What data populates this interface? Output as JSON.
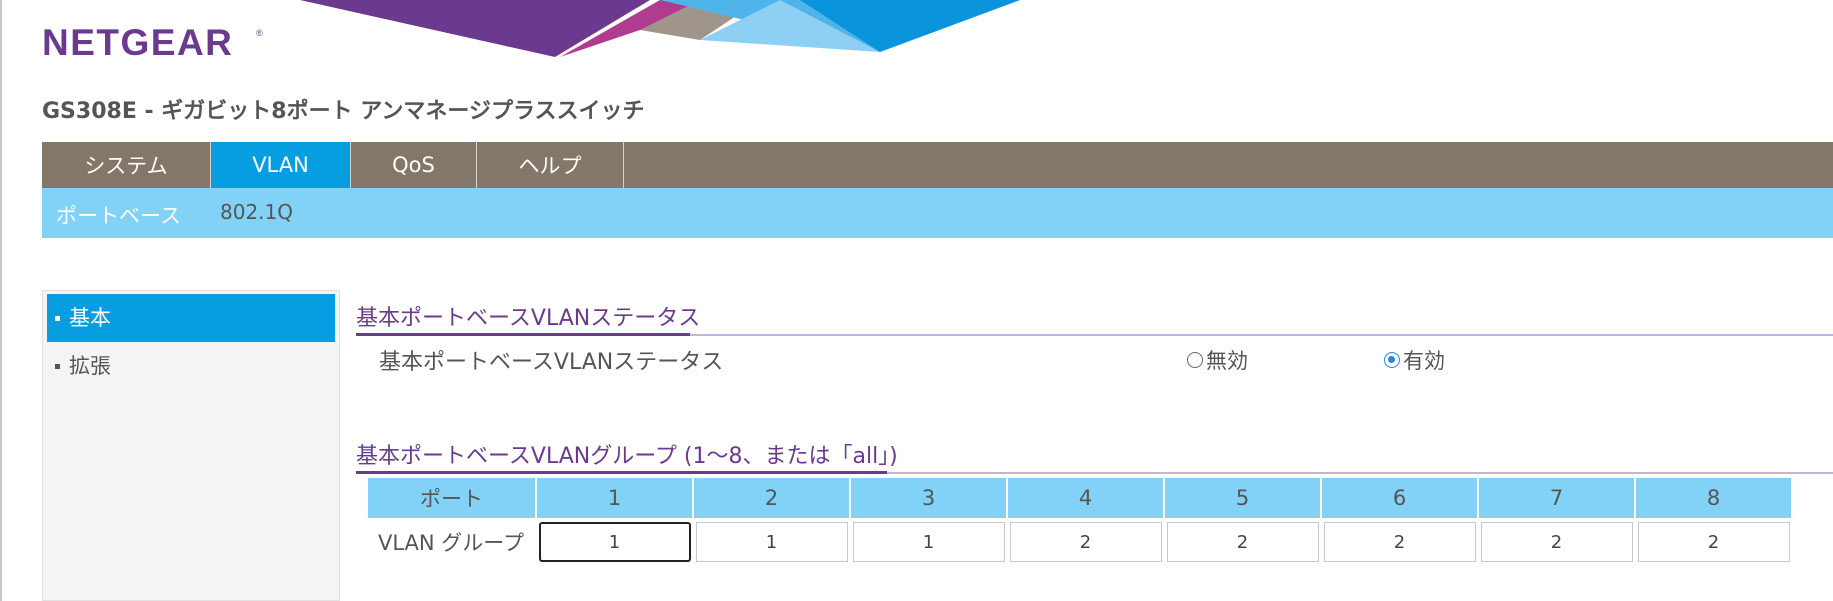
{
  "brand": {
    "logo_text": "NETGEAR",
    "logo_mark": "®",
    "accent_purple": "#6b3a8e",
    "accent_blue": "#069ee0",
    "light_blue": "#82d1f6",
    "nav_brown": "#837769"
  },
  "product_title": "GS308E - ギガビット8ポート アンマネージプラススイッチ",
  "top_nav": [
    {
      "label": "システム",
      "active": false
    },
    {
      "label": "VLAN",
      "active": true
    },
    {
      "label": "QoS",
      "active": false
    },
    {
      "label": "ヘルプ",
      "active": false
    }
  ],
  "sub_nav": [
    {
      "label": "ポートベース",
      "active": true
    },
    {
      "label": "802.1Q",
      "active": false
    }
  ],
  "side_menu": [
    {
      "label": "基本",
      "active": true
    },
    {
      "label": "拡張",
      "active": false
    }
  ],
  "status_section": {
    "title": "基本ポートベースVLANステータス",
    "field_label": "基本ポートベースVLANステータス",
    "options": [
      {
        "label": "無効",
        "checked": false
      },
      {
        "label": "有効",
        "checked": true
      }
    ]
  },
  "group_section": {
    "title": "基本ポートベースVLANグループ (1〜8、または「all」)",
    "port_header": "ポート",
    "row_label": "VLAN グループ",
    "ports": [
      "1",
      "2",
      "3",
      "4",
      "5",
      "6",
      "7",
      "8"
    ],
    "values": [
      "1",
      "1",
      "1",
      "2",
      "2",
      "2",
      "2",
      "2"
    ],
    "focused_index": 0
  }
}
